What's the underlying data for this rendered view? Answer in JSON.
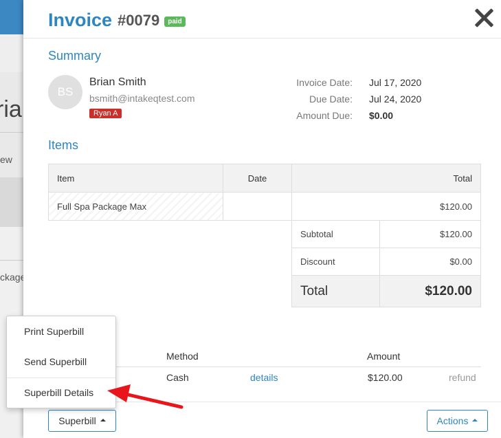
{
  "background": {
    "name_fragment": "rian",
    "text_fragment_1": "ew",
    "text_fragment_2": "ckage"
  },
  "header": {
    "title": "Invoice",
    "invoice_number": "#0079",
    "status_badge": "paid"
  },
  "summary": {
    "section_title": "Summary",
    "avatar_initials": "BS",
    "client_name": "Brian Smith",
    "client_email": "bsmith@intakeqtest.com",
    "staff_tag": "Ryan A",
    "invoice_date_label": "Invoice Date:",
    "invoice_date": "Jul 17, 2020",
    "due_date_label": "Due Date:",
    "due_date": "Jul 24, 2020",
    "amount_due_label": "Amount Due:",
    "amount_due": "$0.00"
  },
  "items": {
    "section_title": "Items",
    "columns": [
      "Item",
      "Date",
      "Total"
    ],
    "rows": [
      {
        "item": "Full Spa Package Max",
        "date": "",
        "total": "$120.00"
      }
    ],
    "subtotal_label": "Subtotal",
    "subtotal": "$120.00",
    "discount_label": "Discount",
    "discount": "$0.00",
    "total_label": "Total",
    "total": "$120.00"
  },
  "payments": {
    "columns": {
      "method": "Method",
      "amount": "Amount"
    },
    "rows": [
      {
        "method": "Cash",
        "details_link": "details",
        "amount": "$120.00",
        "refund_link": "refund"
      }
    ]
  },
  "footer": {
    "superbill_button": "Superbill",
    "actions_button": "Actions"
  },
  "superbill_menu": {
    "items": [
      "Print Superbill",
      "Send Superbill",
      "Superbill Details"
    ]
  },
  "colors": {
    "accent": "#2e86c1",
    "paid_badge": "#5cb85c",
    "staff_tag": "#c9302c",
    "annotation_arrow": "#e8161b"
  }
}
